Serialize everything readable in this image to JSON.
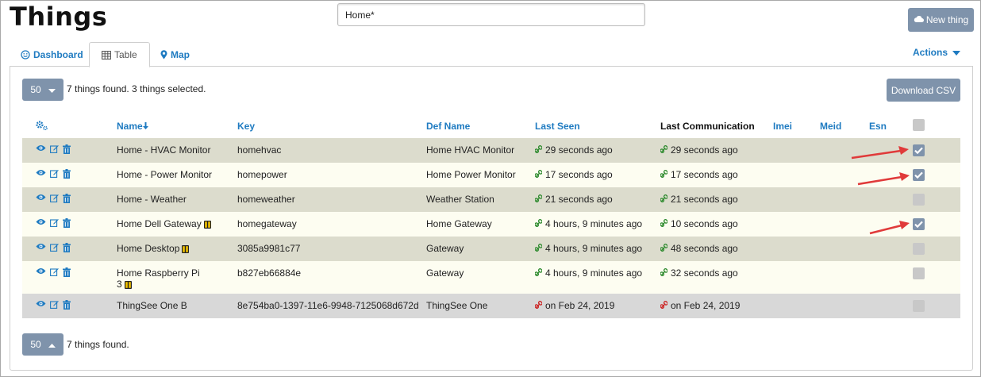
{
  "header": {
    "title": "Things",
    "search_value": "Home*",
    "new_thing_label": "New thing"
  },
  "tabs": [
    {
      "label": "Dashboard",
      "icon": "smile-icon"
    },
    {
      "label": "Table",
      "icon": "table-icon",
      "active": true
    },
    {
      "label": "Map",
      "icon": "map-marker-icon"
    }
  ],
  "actions_label": "Actions",
  "pager": {
    "page_size": "50",
    "top_status": "7 things found. 3 things selected.",
    "bottom_status": "7 things found."
  },
  "download_csv_label": "Download CSV",
  "columns": {
    "name": "Name",
    "key": "Key",
    "def_name": "Def Name",
    "last_seen": "Last Seen",
    "last_communication": "Last Communication",
    "imei": "Imei",
    "meid": "Meid",
    "esn": "Esn"
  },
  "rows": [
    {
      "name": "Home - HVAC Monitor",
      "key": "homehvac",
      "def_name": "Home HVAC Monitor",
      "last_seen": "29 seconds ago",
      "last_comm": "29 seconds ago",
      "connected": true,
      "selected": true,
      "has_badge": false
    },
    {
      "name": "Home - Power Monitor",
      "key": "homepower",
      "def_name": "Home Power Monitor",
      "last_seen": "17 seconds ago",
      "last_comm": "17 seconds ago",
      "connected": true,
      "selected": true,
      "has_badge": false
    },
    {
      "name": "Home - Weather",
      "key": "homeweather",
      "def_name": "Weather Station",
      "last_seen": "21 seconds ago",
      "last_comm": "21 seconds ago",
      "connected": true,
      "selected": false,
      "has_badge": false
    },
    {
      "name": "Home Dell Gateway",
      "key": "homegateway",
      "def_name": "Home Gateway",
      "last_seen": "4 hours, 9 minutes ago",
      "last_comm": "10 seconds ago",
      "connected": true,
      "selected": true,
      "has_badge": true
    },
    {
      "name": "Home Desktop",
      "key": "3085a9981c77",
      "def_name": "Gateway",
      "last_seen": "4 hours, 9 minutes ago",
      "last_comm": "48 seconds ago",
      "connected": true,
      "selected": false,
      "has_badge": true
    },
    {
      "name": "Home Raspberry Pi 3",
      "key": "b827eb66884e",
      "def_name": "Gateway",
      "last_seen": "4 hours, 9 minutes ago",
      "last_comm": "32 seconds ago",
      "connected": true,
      "selected": false,
      "has_badge": true
    },
    {
      "name": "ThingSee One B",
      "key": "8e754ba0-1397-11e6-9948-7125068d672d",
      "def_name": "ThingSee One",
      "last_seen": "on Feb 24, 2019",
      "last_comm": "on Feb 24, 2019",
      "connected": false,
      "selected": false,
      "has_badge": false
    }
  ],
  "colors": {
    "link_blue": "#1f7bc1",
    "button_gray": "#7f93ab",
    "connected_green": "#2d8a2d",
    "disconnected_red": "#cc2222",
    "annotation_red": "#e03a3a"
  }
}
